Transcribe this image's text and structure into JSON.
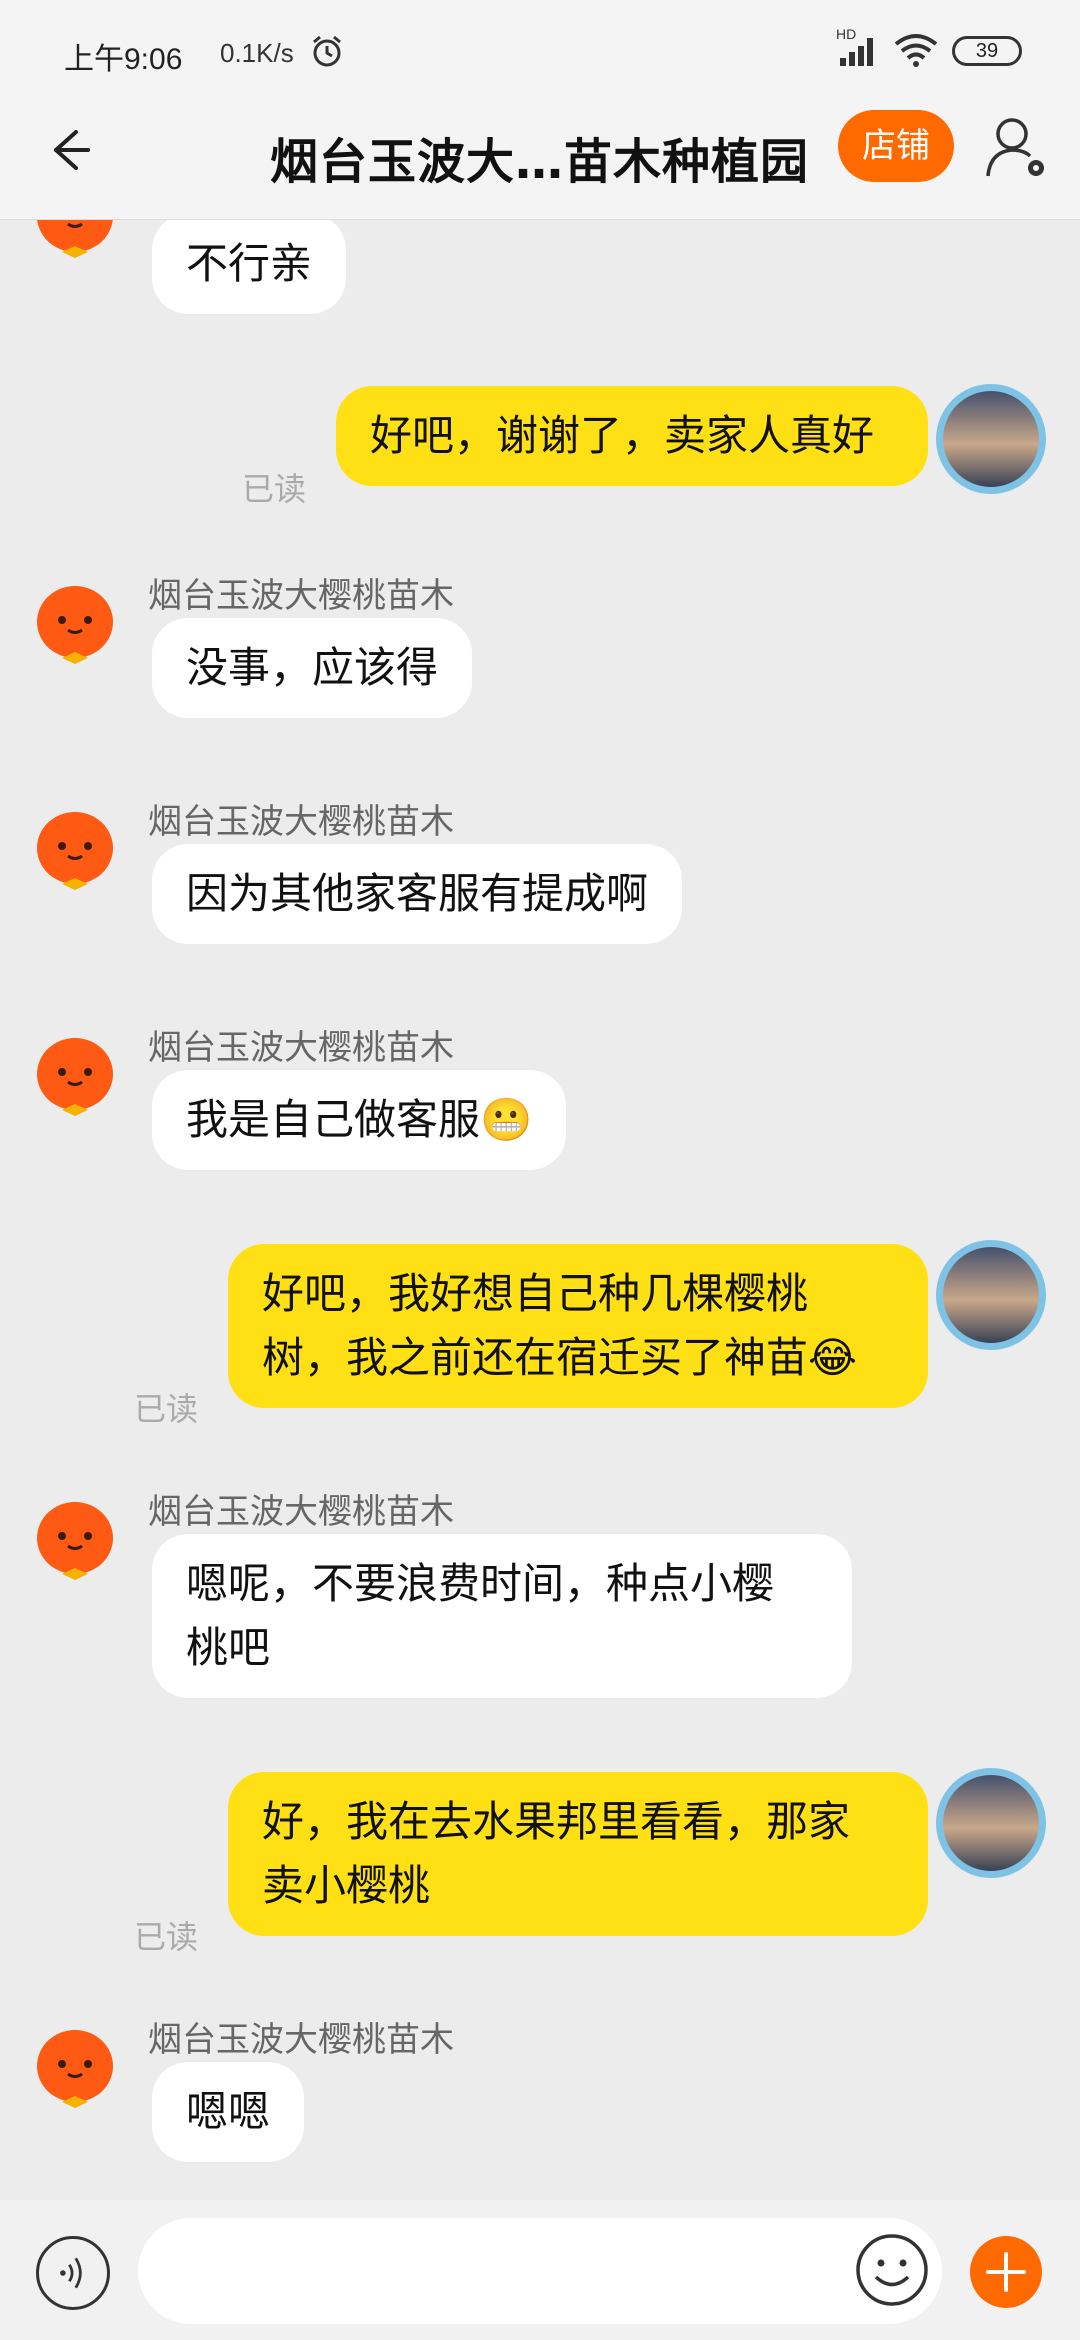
{
  "status_bar": {
    "time_prefix": "上午",
    "time": "9:06",
    "net_speed": "0.1K/s",
    "network_badge": "HD",
    "battery": "39"
  },
  "header": {
    "title": "烟台玉波大…苗木种植园",
    "shop_label": "店铺"
  },
  "messages": [
    {
      "side": "in",
      "sender": "",
      "text": "不行亲"
    },
    {
      "side": "out",
      "text": "好吧，谢谢了，卖家人真好",
      "read_label": "已读"
    },
    {
      "side": "in",
      "sender": "烟台玉波大樱桃苗木",
      "text": "没事，应该得"
    },
    {
      "side": "in",
      "sender": "烟台玉波大樱桃苗木",
      "text": "因为其他家客服有提成啊"
    },
    {
      "side": "in",
      "sender": "烟台玉波大樱桃苗木",
      "text": "我是自己做客服😬"
    },
    {
      "side": "out",
      "text_line1": "好吧，我好想自己种几棵樱桃",
      "text_line2": "树，我之前还在宿迁买了神苗😂",
      "read_label": "已读"
    },
    {
      "side": "in",
      "sender": "烟台玉波大樱桃苗木",
      "text_line1": "嗯呢，不要浪费时间，种点小樱",
      "text_line2": "桃吧"
    },
    {
      "side": "out",
      "text_line1": "好，我在去水果邦里看看，那家",
      "text_line2": "卖小樱桃",
      "read_label": "已读"
    },
    {
      "side": "in",
      "sender": "烟台玉波大樱桃苗木",
      "text": "嗯嗯"
    }
  ],
  "input": {
    "placeholder": ""
  },
  "colors": {
    "accent": "#ff6a00",
    "outgoing_bubble": "#ffe014",
    "incoming_bubble": "#ffffff",
    "background": "#ececec"
  },
  "icons": {
    "back": "arrow-left-icon",
    "user_settings": "user-gear-icon",
    "voice": "voice-icon",
    "emoji": "smiley-icon",
    "plus": "plus-icon",
    "alarm": "alarm-clock-icon",
    "signal": "signal-icon",
    "wifi": "wifi-icon"
  }
}
